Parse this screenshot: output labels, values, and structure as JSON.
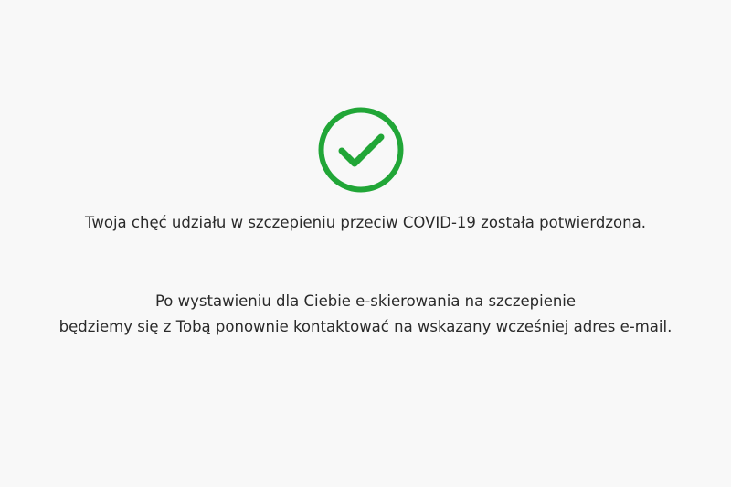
{
  "confirmation": {
    "icon": "check-circle-icon",
    "icon_color": "#21a637",
    "headline": "Twoja chęć udziału w szczepieniu przeciw COVID-19 została potwierdzona.",
    "info_lines": [
      "Po wystawieniu dla Ciebie e-skierowania na szczepienie",
      "będziemy się z Tobą ponownie kontaktować na wskazany wcześniej adres e-mail."
    ]
  }
}
